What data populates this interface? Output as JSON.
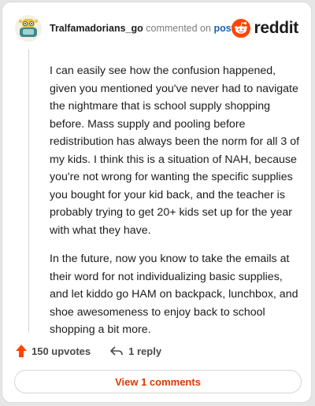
{
  "comment": {
    "username": "Tralfamadorians_go",
    "action_text": "commented on",
    "post_link": "post",
    "brand_wordmark": "reddit",
    "paragraphs": [
      "I can easily see how the confusion happened, given you mentioned you've never had to navigate the nightmare that is school supply shopping before. Mass supply and pooling before redistribution has always been the norm for all 3 of my kids. I think this is a situation of NAH, because you're not wrong for wanting the specific supplies you bought for your kid back, and the teacher is probably trying to get 20+ kids set up for the year with what they have.",
      "In the future, now you know to take the emails at their word for not individualizing basic supplies, and let kiddo go HAM on backpack, lunchbox, and shoe awesomeness to enjoy back to school shopping a bit more."
    ],
    "upvotes_label": "150 upvotes",
    "replies_label": "1 reply",
    "view_comments_label": "View 1 comments"
  },
  "colors": {
    "upvote": "#ff4500",
    "link": "#1a5fb4",
    "view_button": "#d93a00",
    "reddit_orange": "#ff4500"
  },
  "icons": {
    "avatar": "snoo-avatar-icon",
    "logo": "reddit-snoo-icon",
    "upvote": "upvote-arrow-icon",
    "reply": "reply-arrow-icon"
  }
}
